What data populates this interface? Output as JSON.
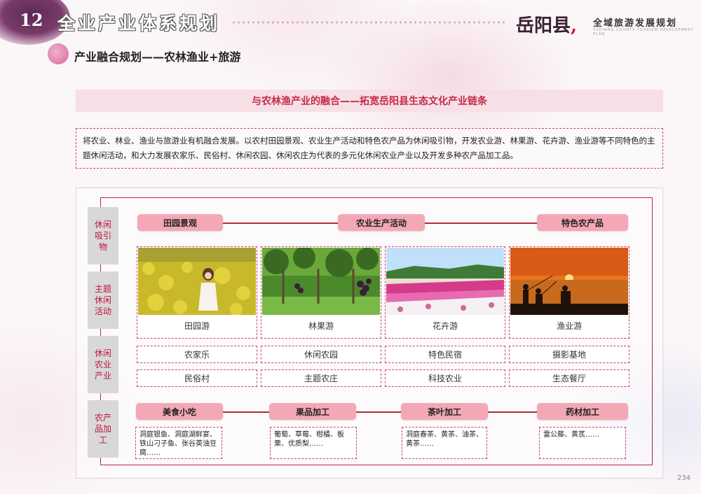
{
  "header": {
    "page_number": "12",
    "main_title": "全业产业体系规划",
    "brand_logo": "岳阳县",
    "brand_subtitle": "全域旅游发展规划",
    "brand_subtitle_en": "YUEYANG COUNTY TOURISM DEVELOPMENT PLAN"
  },
  "section_title": "产业融合规划——农林渔业+旅游",
  "banner_title": "与农林渔产业的融合——拓宽岳阳县生态文化产业链条",
  "intro_text": "将农业、林业、渔业与旅游业有机融合发展。以农村田园景观、农业生产活动和特色农产品为休闲吸引物，开发农业游、林果游、花卉游、渔业游等不同特色的主题休闲活动，和大力发展农家乐、民俗村、休闲农园、休闲农庄为代表的多元化休闲农业产业以及开发多种农产品加工品。",
  "side_labels": [
    "休闲吸引物",
    "主题休闲活动",
    "休闲农业产业",
    "农产品加工"
  ],
  "attractions": [
    "田园景观",
    "农业生产活动",
    "特色农产品"
  ],
  "activities": [
    {
      "caption": "田园游",
      "image": "rapeseed-field-photo"
    },
    {
      "caption": "林果游",
      "image": "vineyard-photo"
    },
    {
      "caption": "花卉游",
      "image": "flower-field-photo"
    },
    {
      "caption": "渔业游",
      "image": "sunset-fishing-photo"
    }
  ],
  "industry_row1": [
    "农家乐",
    "休闲农园",
    "特色民宿",
    "摄影基地"
  ],
  "industry_row2": [
    "民俗村",
    "主题农庄",
    "科技农业",
    "生态餐厅"
  ],
  "processing": [
    {
      "category": "美食小吃",
      "products": "洞庭银鱼、洞庭湖鲜宴、铁山刁子鱼、张谷英油豆腐……"
    },
    {
      "category": "果品加工",
      "products": "葡萄、草莓、柑橘、板栗、优质梨……"
    },
    {
      "category": "茶叶加工",
      "products": "洞庭春茶、黄茶、油茶、黄茶……"
    },
    {
      "category": "药材加工",
      "products": "雷公藤、黄芪……"
    }
  ],
  "page_footer": "234",
  "colors": {
    "accent": "#c42a48",
    "pill": "#f4a8b6",
    "frame": "#b3283e",
    "side_label_bg": "#d8d8d8"
  }
}
